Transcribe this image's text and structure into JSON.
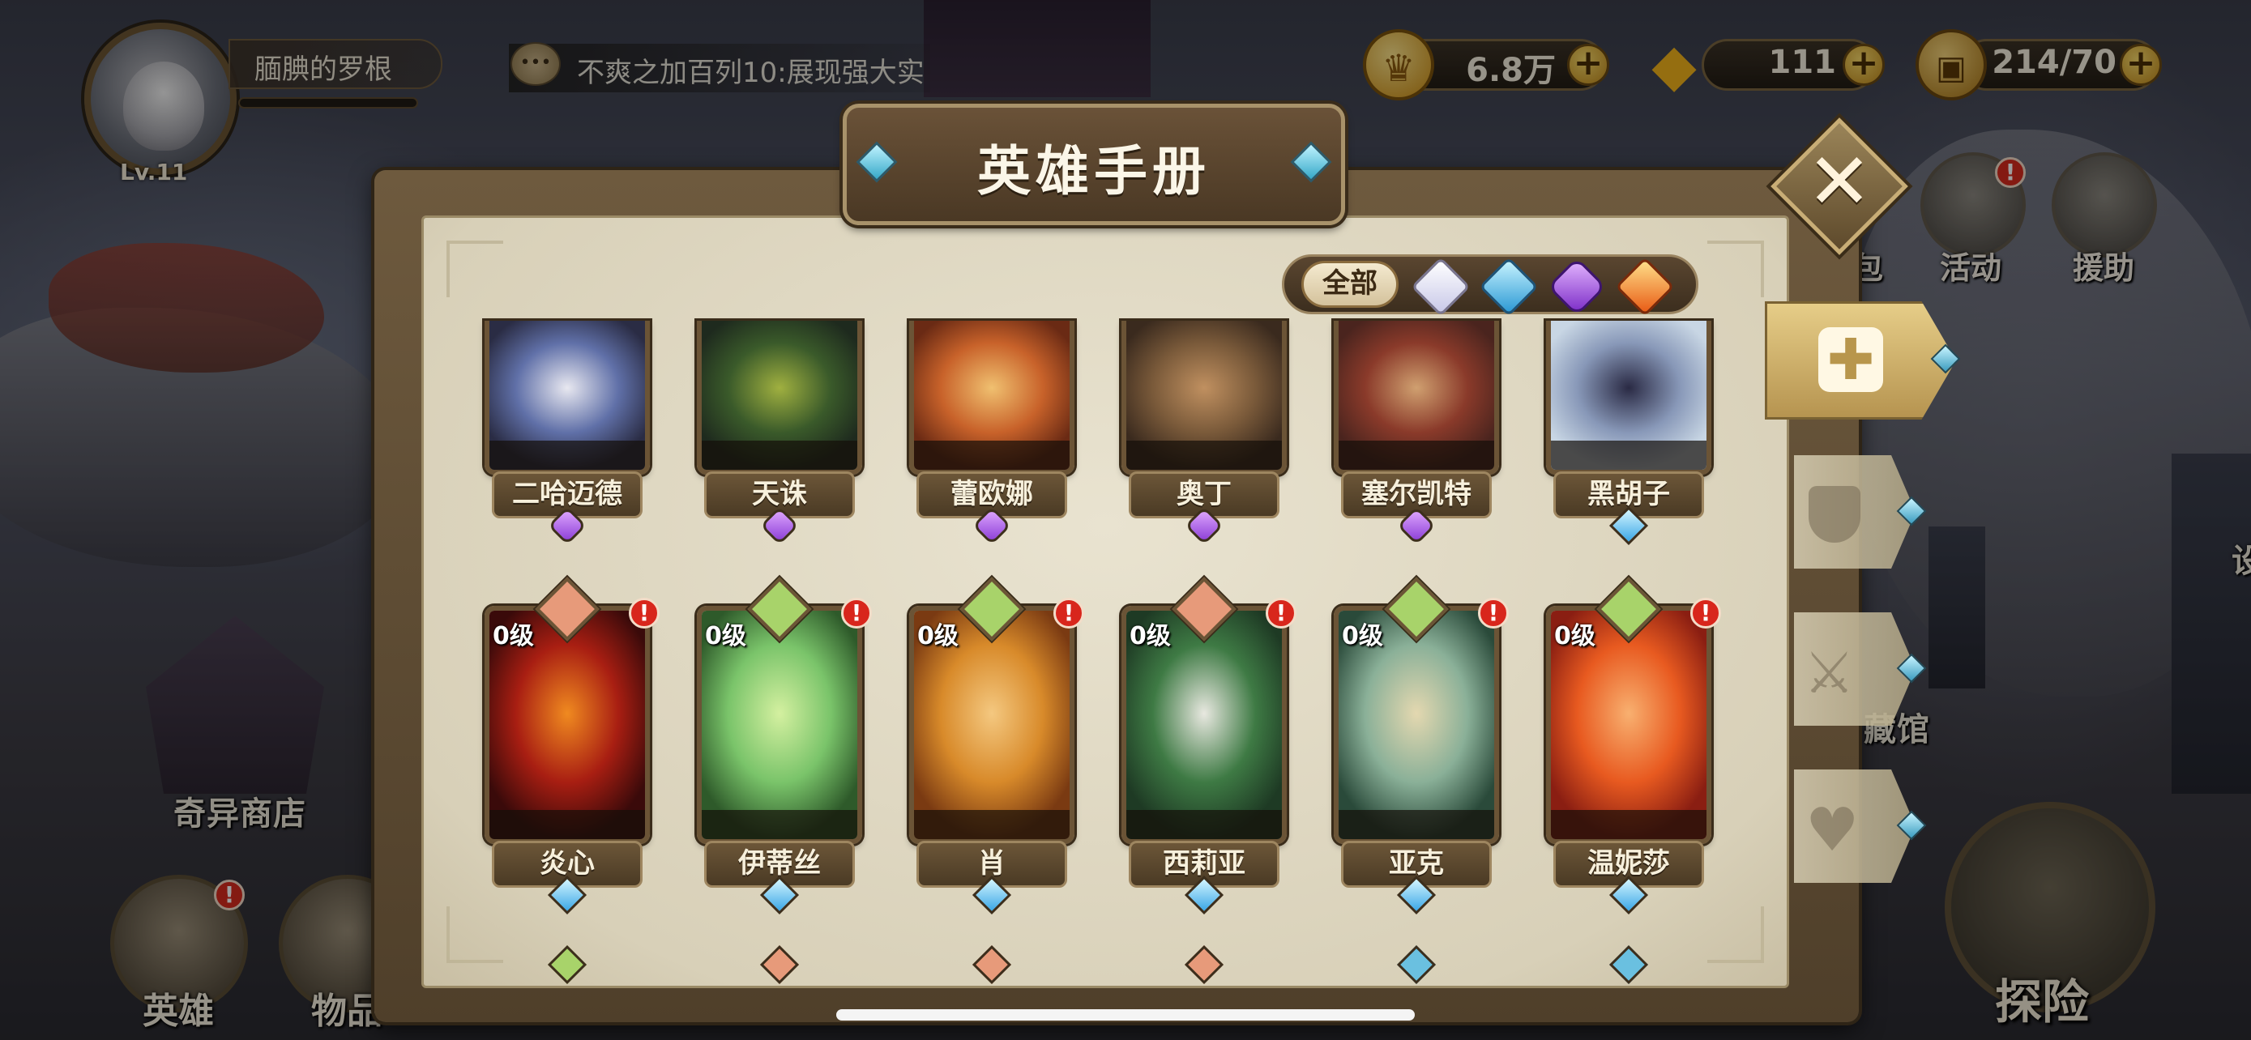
{
  "player": {
    "name": "腼腆的罗根",
    "level": "Lv.11"
  },
  "chat": {
    "message": "不爽之加百列10:展现强大实"
  },
  "currencies": [
    {
      "name": "gold",
      "icon": "gold-coin-icon",
      "value": "6.8万"
    },
    {
      "name": "diamond",
      "icon": "diamond-icon",
      "value": "111"
    },
    {
      "name": "stamina",
      "icon": "treasure-chest-icon",
      "value": "214/70"
    }
  ],
  "plus_label": "+",
  "side_menu": {
    "bag_label": "包",
    "events_label": "活动",
    "support_label": "援助",
    "alert": "!"
  },
  "scene": {
    "shop_label": "奇异商店",
    "hall_label": "藏馆",
    "right_edge_label": "设"
  },
  "bottom_nav": {
    "heroes_label": "英雄",
    "items_label": "物品",
    "alert": "!"
  },
  "explore": {
    "label": "探险"
  },
  "modal": {
    "title": "英雄手册",
    "close_label": "✕",
    "filters": {
      "all_label": "全部",
      "options": [
        "white-rarity-icon",
        "blue-rarity-icon",
        "purple-rarity-icon",
        "orange-rarity-icon"
      ]
    },
    "tabs": [
      "all-heroes-icon",
      "shield-icon",
      "sword-icon",
      "heart-icon"
    ],
    "tab_active_icon": "✚",
    "heroes_row1": [
      {
        "name": "二哈迈德",
        "rarity": "purple"
      },
      {
        "name": "天诛",
        "rarity": "purple"
      },
      {
        "name": "蕾欧娜",
        "rarity": "purple"
      },
      {
        "name": "奥丁",
        "rarity": "purple"
      },
      {
        "name": "塞尔凯特",
        "rarity": "purple"
      },
      {
        "name": "黑胡子",
        "rarity": "blue"
      }
    ],
    "heroes_row2": [
      {
        "name": "炎心",
        "level": "0级",
        "rarity": "blue",
        "class": "warrior",
        "alert": "!"
      },
      {
        "name": "伊蒂丝",
        "level": "0级",
        "rarity": "blue",
        "class": "support",
        "alert": "!"
      },
      {
        "name": "肖",
        "level": "0级",
        "rarity": "blue",
        "class": "support",
        "alert": "!"
      },
      {
        "name": "西莉亚",
        "level": "0级",
        "rarity": "blue",
        "class": "warrior",
        "alert": "!"
      },
      {
        "name": "亚克",
        "level": "0级",
        "rarity": "blue",
        "class": "support",
        "alert": "!"
      },
      {
        "name": "温妮莎",
        "level": "0级",
        "rarity": "blue",
        "class": "support",
        "alert": "!"
      }
    ]
  },
  "colors": {
    "purple": "#8a3cd6",
    "blue": "#3aa6e6",
    "warrior_badge": "#e79a7a",
    "support_badge": "#a8d36a",
    "paper": "#e4ddc8",
    "frame": "#5e4a30"
  }
}
